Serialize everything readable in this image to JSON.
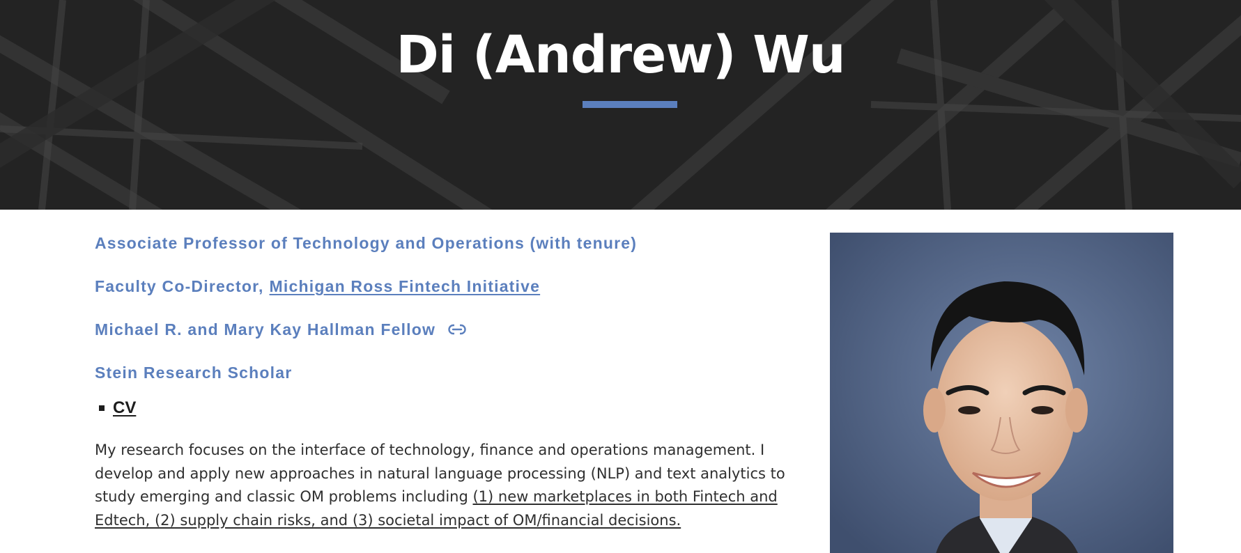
{
  "header": {
    "name": "Di (Andrew) Wu"
  },
  "roles": {
    "title": "Associate Professor of Technology and Operations (with tenure)",
    "codirector_prefix": "Faculty Co-Director,",
    "codirector_link": "Michigan Ross Fintech Initiative",
    "fellow": "Michael R. and Mary Kay Hallman Fellow",
    "scholar": "Stein Research Scholar"
  },
  "links": {
    "cv": "CV"
  },
  "bio": {
    "text": "My research focuses on the interface of technology, finance and operations management. I develop and apply new approaches in natural language processing (NLP) and text analytics to study emerging and classic OM problems including ",
    "link": "(1) new marketplaces in both Fintech and Edtech, (2) supply chain risks, and (3) societal impact of OM/financial decisions."
  },
  "icons": {
    "fellow_link": "link-icon",
    "bullet": "square-bullet"
  },
  "colors": {
    "accent": "#5b7fbd",
    "hero_bg": "#232323",
    "text": "#2f2f2f"
  }
}
